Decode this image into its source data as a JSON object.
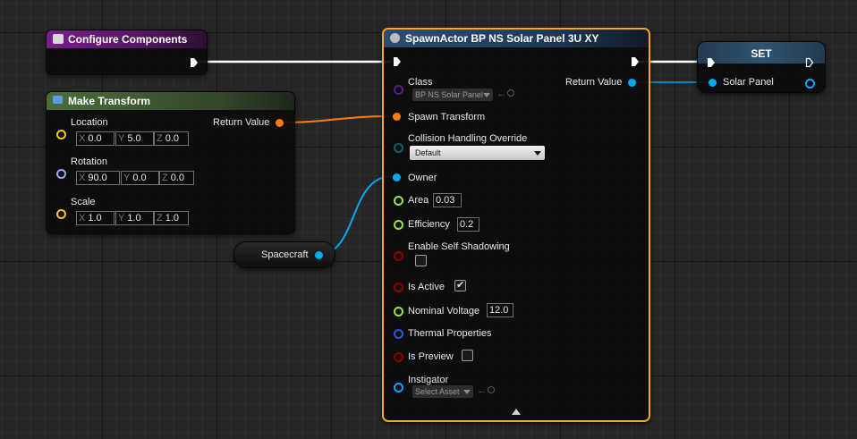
{
  "nodes": {
    "configure": {
      "title": "Configure Components",
      "color": "#7a1f8c"
    },
    "make_transform": {
      "title": "Make Transform",
      "color": "#4b6d3c",
      "location": {
        "label": "Location",
        "x": "0.0",
        "y": "5.0",
        "z": "0.0"
      },
      "rotation": {
        "label": "Rotation",
        "x": "90.0",
        "y": "0.0",
        "z": "0.0"
      },
      "scale": {
        "label": "Scale",
        "x": "1.0",
        "y": "1.0",
        "z": "1.0"
      },
      "return_label": "Return Value"
    },
    "spacecraft": {
      "label": "Spacecraft"
    },
    "spawn": {
      "title": "SpawnActor BP NS Solar Panel 3U XY",
      "color": "#2b4d72",
      "class": {
        "label": "Class",
        "value": "BP NS Solar Panel"
      },
      "return_label": "Return Value",
      "spawn_transform": "Spawn Transform",
      "collision": {
        "label": "Collision Handling Override",
        "value": "Default"
      },
      "owner": "Owner",
      "area": {
        "label": "Area",
        "value": "0.03"
      },
      "efficiency": {
        "label": "Efficiency",
        "value": "0.2"
      },
      "self_shadowing": {
        "label": "Enable Self Shadowing"
      },
      "is_active": {
        "label": "Is Active",
        "checked": true
      },
      "nominal_voltage": {
        "label": "Nominal Voltage",
        "value": "12.0"
      },
      "thermal": "Thermal Properties",
      "is_preview": {
        "label": "Is Preview",
        "checked": false
      },
      "instigator": {
        "label": "Instigator",
        "value": "Select Asset"
      }
    },
    "set": {
      "title": "SET",
      "pin_label": "Solar Panel"
    }
  },
  "axis_labels": {
    "x": "X",
    "y": "Y",
    "z": "Z"
  },
  "colors": {
    "exec": "#ffffff",
    "struct": "#ff7b0e",
    "object": "#00a9f1",
    "float": "#99e44c",
    "bool": "#8c0000",
    "class": "#5a1d80",
    "enum": "#0a6065",
    "thermal": "#2a58d4",
    "vector": "#f8c522",
    "rotator": "#9ea5ff",
    "selected": "#f5a623"
  }
}
